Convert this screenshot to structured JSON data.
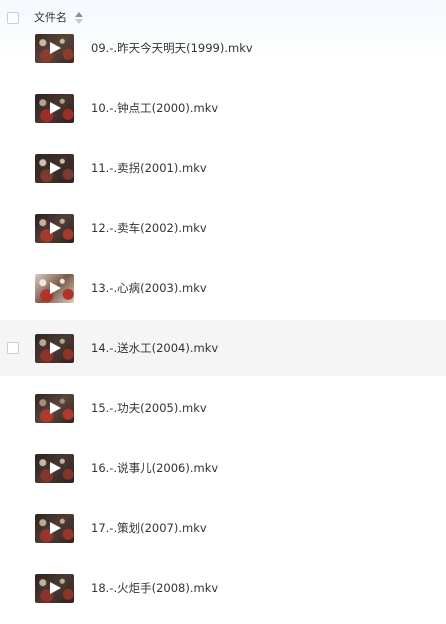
{
  "header": {
    "column_label": "文件名",
    "sort_icon": "sort-arrows-icon"
  },
  "files": [
    {
      "name": "09.-.昨天今天明天(1999).mkv",
      "icon": "video-play-icon",
      "selected": false
    },
    {
      "name": "10.-.钟点工(2000).mkv",
      "icon": "video-play-icon",
      "selected": false
    },
    {
      "name": "11.-.卖拐(2001).mkv",
      "icon": "video-play-icon",
      "selected": false
    },
    {
      "name": "12.-.卖车(2002).mkv",
      "icon": "video-play-icon",
      "selected": false
    },
    {
      "name": "13.-.心病(2003).mkv",
      "icon": "video-play-icon",
      "selected": false
    },
    {
      "name": "14.-.送水工(2004).mkv",
      "icon": "video-play-icon",
      "selected": true
    },
    {
      "name": "15.-.功夫(2005).mkv",
      "icon": "video-play-icon",
      "selected": false
    },
    {
      "name": "16.-.说事儿(2006).mkv",
      "icon": "video-play-icon",
      "selected": false
    },
    {
      "name": "17.-.策划(2007).mkv",
      "icon": "video-play-icon",
      "selected": false
    },
    {
      "name": "18.-.火炬手(2008).mkv",
      "icon": "video-play-icon",
      "selected": false
    }
  ],
  "colors": {
    "selected_row_bg": "#f5f5f5",
    "text": "#333333",
    "checkbox_border": "#c9cdd4"
  }
}
